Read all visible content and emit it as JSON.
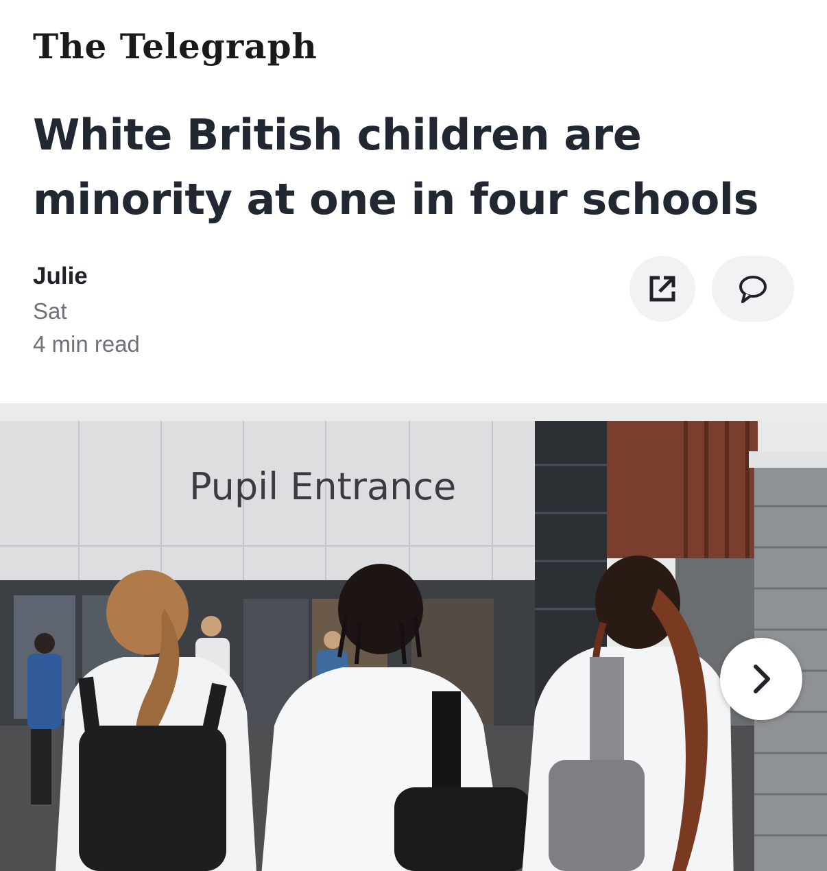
{
  "header": {
    "publisher": "The Telegraph"
  },
  "article": {
    "headline": "White British children are minority at one in four schools",
    "author": "Julie",
    "date": "Sat",
    "read_time": "4 min read"
  },
  "actions": {
    "share_icon": "open-external-icon",
    "comments_icon": "speech-bubble-icon"
  },
  "hero_image": {
    "sign_text": "Pupil Entrance",
    "next_icon": "chevron-right-icon"
  },
  "colors": {
    "headline": "#222831",
    "meta": "#6d7278",
    "button_bg": "#f1f2f3"
  }
}
